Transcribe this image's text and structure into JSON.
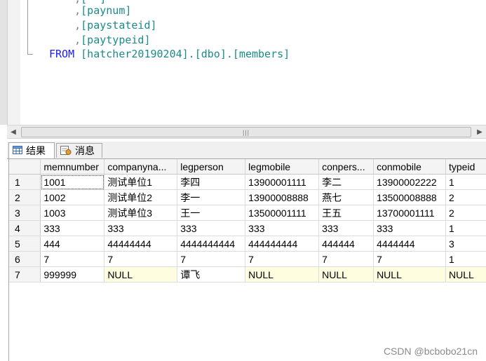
{
  "editor": {
    "lines": [
      {
        "prefix": "    ,",
        "text": "[paynum]"
      },
      {
        "prefix": "    ,",
        "text": "[paystateid]"
      },
      {
        "prefix": "    ,",
        "text": "[paytypeid]"
      }
    ],
    "from_keyword": "FROM",
    "from_target": "[hatcher20190204].[dbo].[members]"
  },
  "tabs": [
    {
      "label": "结果",
      "icon": "grid-results-icon"
    },
    {
      "label": "消息",
      "icon": "messages-icon"
    }
  ],
  "grid": {
    "columns": [
      "memnumber",
      "companyna...",
      "legperson",
      "legmobile",
      "conpers...",
      "conmobile",
      "typeid"
    ],
    "rows": [
      {
        "num": "1",
        "cells": [
          "1001",
          "测试单位1",
          "李四",
          "13900001111",
          "李二",
          "13900002222",
          "1"
        ]
      },
      {
        "num": "2",
        "cells": [
          "1002",
          "测试单位2",
          "李一",
          "13900008888",
          "燕七",
          "13500008888",
          "2"
        ]
      },
      {
        "num": "3",
        "cells": [
          "1003",
          "测试单位3",
          "王一",
          "13500001111",
          "王五",
          "13700001111",
          "2"
        ]
      },
      {
        "num": "4",
        "cells": [
          "333",
          "333",
          "333",
          "333",
          "333",
          "333",
          "1"
        ]
      },
      {
        "num": "5",
        "cells": [
          "444",
          "44444444",
          "4444444444",
          "444444444",
          "444444",
          "4444444",
          "3"
        ]
      },
      {
        "num": "6",
        "cells": [
          "7",
          "7",
          "7",
          "7",
          "7",
          "7",
          "1"
        ]
      },
      {
        "num": "7",
        "cells": [
          "999999",
          "NULL",
          "谭飞",
          "NULL",
          "NULL",
          "NULL",
          "NULL"
        ]
      }
    ],
    "null_color": "#fffde0"
  },
  "watermark": "CSDN @bcbobo21cn"
}
